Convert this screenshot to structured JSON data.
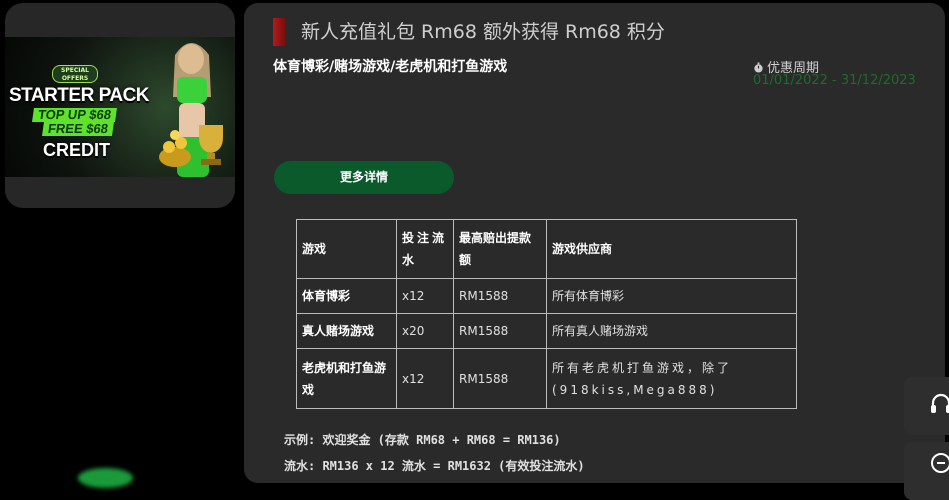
{
  "banner": {
    "badge": "SPECIAL OFFERS",
    "title": "STARTER PACK",
    "line1": "TOP UP $68",
    "line2": "FREE $68",
    "credit": "CREDIT"
  },
  "promo": {
    "title": "新人充值礼包 Rm68 额外获得 Rm68 积分",
    "categories": "体育博彩/赌场游戏/老虎机和打鱼游戏",
    "period_label": "优惠周期",
    "period_value": "01/01/2022 - 31/12/2023",
    "details_button": "更多详情"
  },
  "table": {
    "headers": [
      "游戏",
      "投注流水",
      "最高赔出提款额",
      "游戏供应商"
    ],
    "rows": [
      [
        "体育博彩",
        "x12",
        "RM1588",
        "所有体育博彩"
      ],
      [
        "真人赌场游戏",
        "x20",
        "RM1588",
        "所有真人赌场游戏"
      ],
      [
        "老虎机和打鱼游戏",
        "x12",
        "RM1588",
        "所有老虎机打鱼游戏，除了(918kiss,Mega888)"
      ]
    ]
  },
  "examples": {
    "line1": "示例: 欢迎奖金 (存款 RM68 + RM68 = RM136)",
    "line2": "流水: RM136 x 12 流水 = RM1632 (有效投注流水)"
  },
  "colors": {
    "accent_red": "#b01c1c",
    "button_green": "#0a5a2b",
    "period_green": "#1e6b2a"
  }
}
